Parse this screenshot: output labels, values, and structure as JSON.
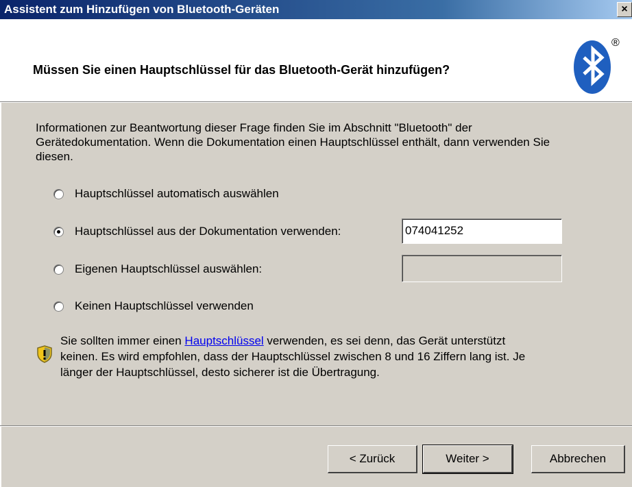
{
  "window": {
    "title": "Assistent zum Hinzufügen von Bluetooth-Geräten",
    "close_label": "×"
  },
  "header": {
    "question": "Müssen Sie einen Hauptschlüssel für das Bluetooth-Gerät hinzufügen?",
    "logo_registered": "®",
    "brand_color": "#1f5fbf"
  },
  "body": {
    "description": "Informationen zur Beantwortung dieser Frage finden Sie im Abschnitt \"Bluetooth\" der Gerätedokumentation. Wenn die Dokumentation einen Hauptschlüssel enthält, dann verwenden Sie diesen."
  },
  "options": [
    {
      "label": "Hauptschlüssel automatisch auswählen",
      "checked": false
    },
    {
      "label": "Hauptschlüssel aus der Dokumentation verwenden:",
      "checked": true
    },
    {
      "label": "Eigenen Hauptschlüssel auswählen:",
      "checked": false
    },
    {
      "label": "Keinen Hauptschlüssel verwenden",
      "checked": false
    }
  ],
  "fields": {
    "documentation_key": "074041252",
    "custom_key": ""
  },
  "note": {
    "before_link": "Sie sollten immer einen ",
    "link": "Hauptschlüssel",
    "after_link": " verwenden, es sei denn, das Gerät unterstützt keinen. Es wird empfohlen, dass der Hauptschlüssel zwischen 8 und 16 Ziffern lang ist. Je länger der Hauptschlüssel, desto sicherer ist die Übertragung.",
    "icon": "shield-warning-icon"
  },
  "buttons": {
    "back": "< Zurück",
    "next": "Weiter >",
    "cancel": "Abbrechen"
  }
}
